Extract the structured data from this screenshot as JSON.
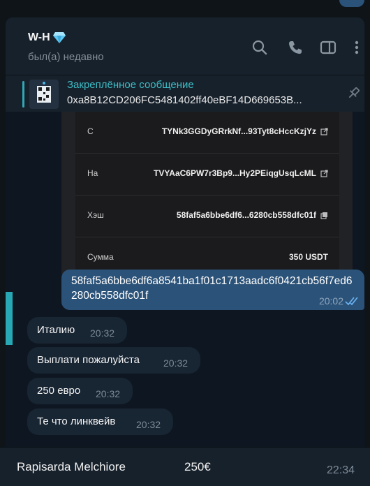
{
  "header": {
    "contact_name": "W-H",
    "status": "был(а) недавно",
    "icons": [
      "diamond-icon",
      "search-icon",
      "phone-icon",
      "sidebar-toggle-icon",
      "more-icon"
    ]
  },
  "pinned": {
    "title": "Закреплённое сообщение",
    "text": "0xa8B12CD206FC5481402ff40eBF14D669653B..."
  },
  "screenshot": {
    "rows": [
      {
        "label": "С",
        "value": "TYNk3GGDyGRrkNf...93Tyt8cHccKzjYz",
        "icon": "external-link-icon"
      },
      {
        "label": "На",
        "value": "TVYAaC6PW7r3Bp9...Hy2PEiqgUsqLcML",
        "icon": "external-link-icon"
      },
      {
        "label": "Хэш",
        "value": "58faf5a6bbe6df6...6280cb558dfc01f",
        "icon": "copy-icon"
      },
      {
        "label": "Сумма",
        "value": "350 USDT",
        "icon": ""
      }
    ]
  },
  "outgoing": {
    "text": "58faf5a6bbe6df6a8541ba1f01c1713aadc6f0421cb56f7ed6280cb558dfc01f",
    "time": "20:02",
    "status_icon": "double-check-icon"
  },
  "incoming": [
    {
      "text": "Италию",
      "time": "20:32"
    },
    {
      "text": "Выплати пожалуйста",
      "time": "20:32"
    },
    {
      "text": "250 евро",
      "time": "20:32"
    },
    {
      "text": "Те что линквейв",
      "time": "20:32"
    }
  ],
  "bottom": {
    "name": "Rapisarda Melchiore",
    "amount": "250€",
    "time": "22:34"
  },
  "colors": {
    "background": "#0e1621",
    "header": "#17212b",
    "outgoing_bubble": "#2b5278",
    "incoming_bubble": "#182533",
    "accent": "#3dbcc5"
  }
}
